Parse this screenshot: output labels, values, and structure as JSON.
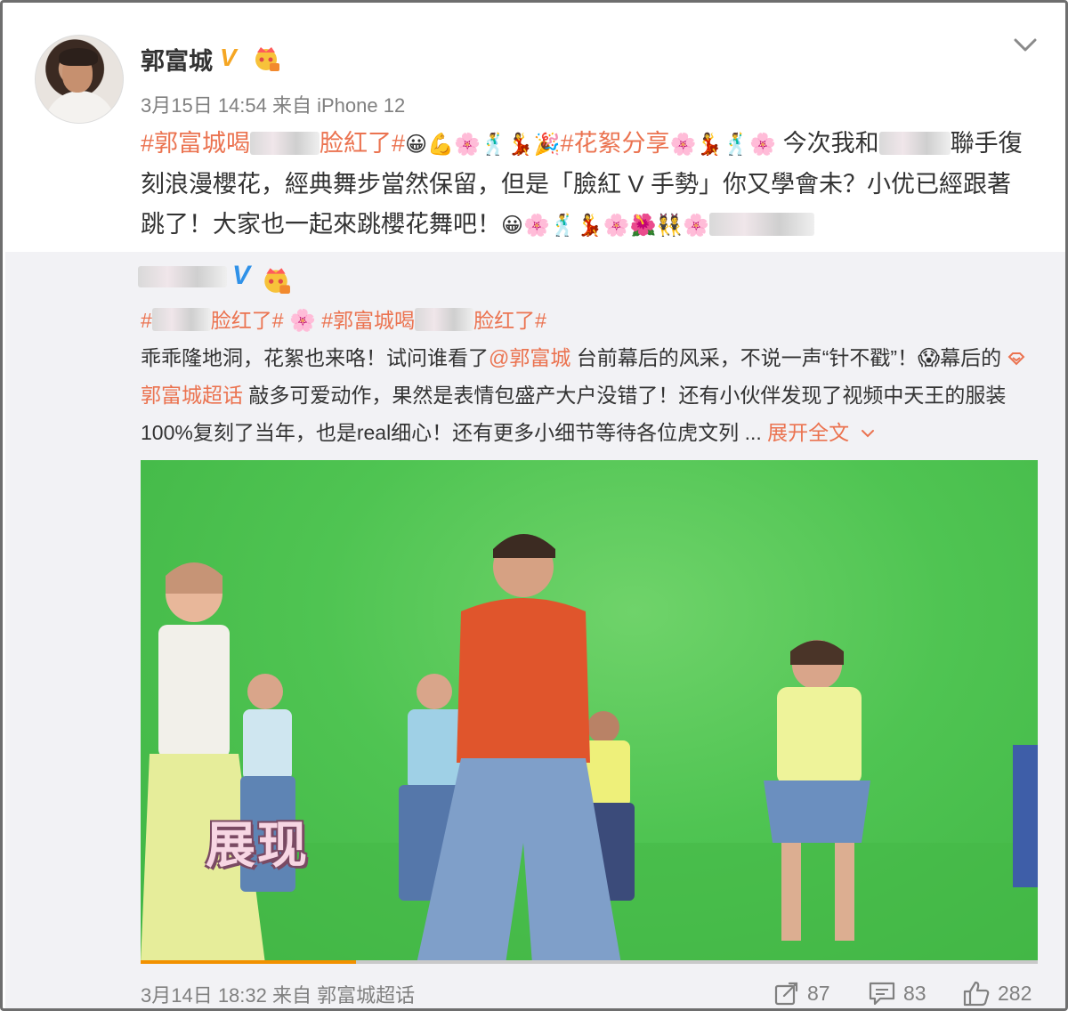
{
  "post": {
    "author": "郭富城",
    "verified_badge": "V",
    "meta": "3月15日 14:54 来自 iPhone 12",
    "text_segments": {
      "tag1_start": "#郭富城喝",
      "tag1_end": "脸紅了#",
      "emoji_group1": "😀💪🌸🕺💃🎉",
      "tag2": "#花絮分享",
      "emoji_group2": "🌸💃🕺🌸",
      "body1": " 今次我和",
      "body2": "聯手復刻浪漫櫻花，經典舞步當然保留，但是「臉紅 V 手勢」你又學會未？小优已經跟著跳了！大家也一起來跳櫻花舞吧！",
      "emoji_group3": "😀🌸🕺💃🌸🌺👯🌸"
    }
  },
  "repost": {
    "verified_badge": "V",
    "tags_line": {
      "tag_a_start": "#",
      "tag_a_end": "脸红了#",
      "flower": "🌸",
      "tag_b_start": "#郭富城喝",
      "tag_b_end": "脸红了#"
    },
    "text": {
      "part1": "乖乖隆地洞，花絮也来咯！试问谁看了",
      "mention": "@郭富城",
      "part2": " 台前幕后的风采，不说一声“针不戳”！",
      "emoji": "😱",
      "part3": "幕后的 ",
      "supertopic": "郭富城超话",
      "part4": " 敲多可爱动作，果然是表情包盛产大户没错了！还有小伙伴发现了视频中天王的服装100%复刻了当年，也是real细心！还有更多小细节等待各位虎文列 ... ",
      "expand": "展开全文"
    },
    "video": {
      "caption": "展现",
      "progress": 0.24
    },
    "footer_meta": "3月14日 18:32 来自 郭富城超话",
    "actions": {
      "repost_count": "87",
      "comment_count": "83",
      "like_count": "282"
    }
  },
  "colors": {
    "tag": "#eb7350",
    "repost_bg": "#f2f2f5",
    "green_screen": "#4fc452",
    "progress": "#f29100"
  },
  "icons": [
    "chevron-down-icon",
    "crown-badge-icon",
    "share-icon",
    "comment-icon",
    "like-icon",
    "supertopic-icon"
  ]
}
